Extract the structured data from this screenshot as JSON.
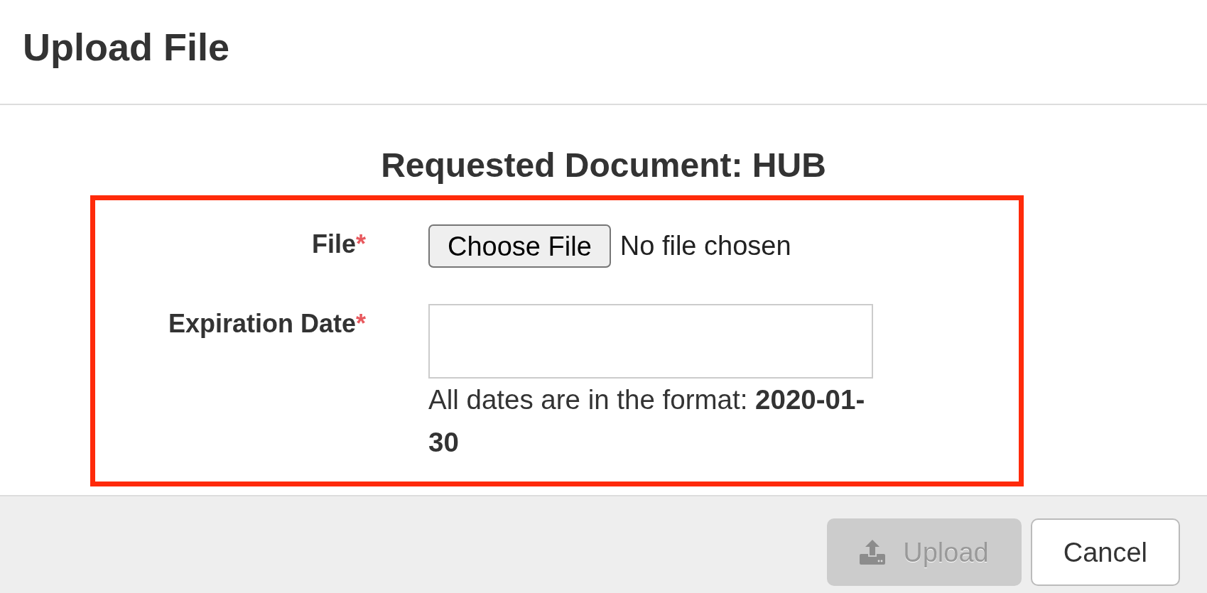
{
  "header": {
    "title": "Upload File"
  },
  "body": {
    "heading": "Requested Document: HUB",
    "form": {
      "highlighted": true,
      "fields": [
        {
          "kind": "file",
          "label": "File",
          "required_mark": "*",
          "button": "Choose File",
          "status": "No file chosen"
        },
        {
          "kind": "date",
          "label": "Expiration Date",
          "required_mark": "*",
          "help": "All dates are in the format: **2020-01-30**"
        }
      ]
    }
  },
  "footer": {
    "buttons": [
      {
        "kind": "upload",
        "label": "Upload",
        "disabled": true
      },
      {
        "kind": "cancel",
        "label": "Cancel",
        "disabled": false
      }
    ]
  }
}
